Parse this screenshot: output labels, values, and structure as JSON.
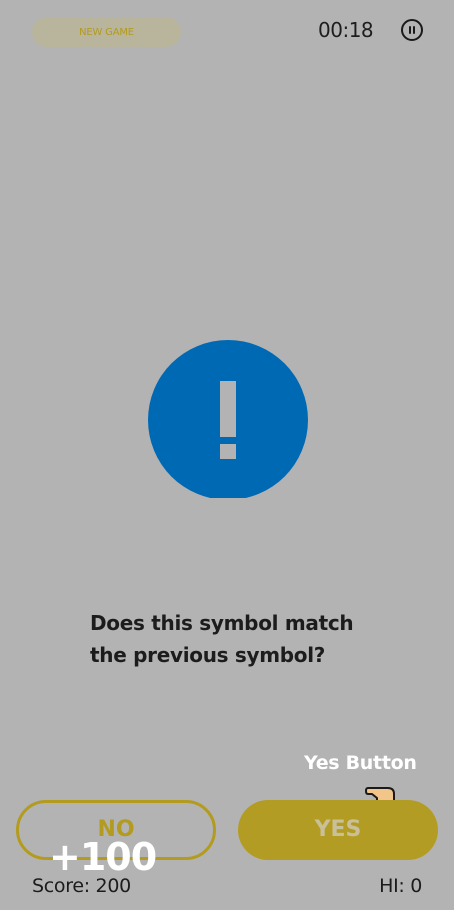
{
  "header": {
    "new_game_label": "NEW GAME",
    "timer": "00:18",
    "pause_icon": "pause-circle-icon"
  },
  "symbol": {
    "icon": "exclamation-circle-icon",
    "color": "#0069b4"
  },
  "question": {
    "line1": "Does this symbol match",
    "line2": "the previous symbol?"
  },
  "hint": {
    "label": "Yes Button",
    "icon": "hand-pointer-icon"
  },
  "answers": {
    "no_label": "NO",
    "yes_label": "YES"
  },
  "score_popup": "+100",
  "footer": {
    "score": "Score: 200",
    "hi_score": "HI: 0"
  },
  "colors": {
    "background": "#b3b3b3",
    "accent": "#b39c24",
    "symbol": "#0069b4"
  }
}
